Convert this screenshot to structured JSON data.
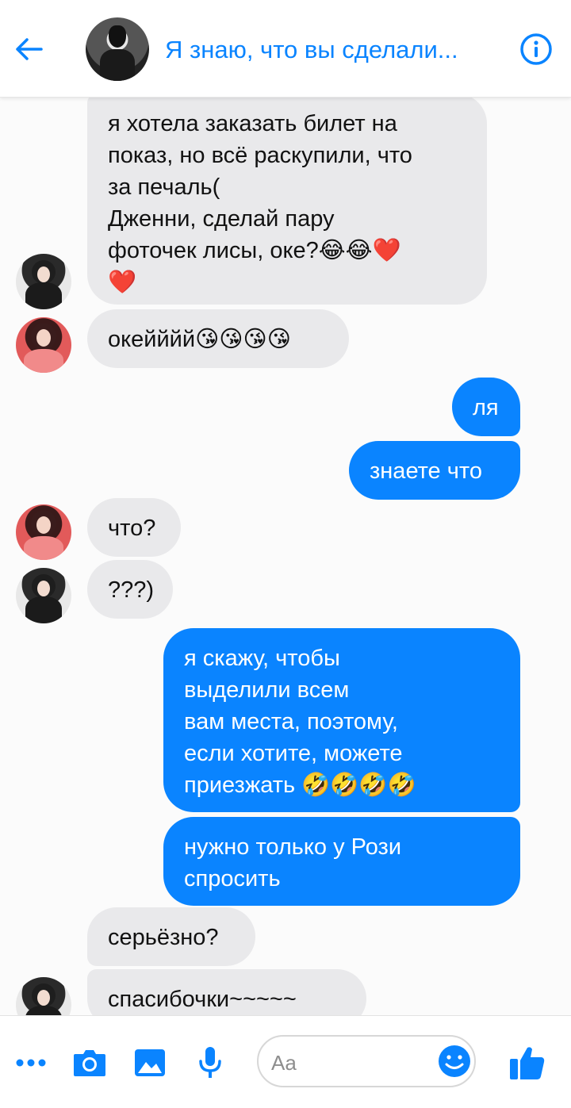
{
  "header": {
    "title": "Я знаю, что вы сделали...",
    "back_icon": "back-arrow-icon",
    "info_icon": "info-icon"
  },
  "colors": {
    "accent": "#0a84ff",
    "incoming_bubble": "#e9e9eb",
    "outgoing_bubble": "#0a84ff"
  },
  "messages": [
    {
      "side": "in",
      "avatar": "dark",
      "text": "я хотела заказать билет на\nпоказ, но всё раскупили, что\nза печаль(\nДженни, сделай пару\nфоточек лисы, оке?😂😂❤️\n❤️"
    },
    {
      "side": "in",
      "avatar": "pink",
      "text": "окейййй😘😘😘😘"
    },
    {
      "side": "out",
      "text": "ля"
    },
    {
      "side": "out",
      "text": "знаете что"
    },
    {
      "side": "in",
      "avatar": "pink",
      "text": "что?"
    },
    {
      "side": "in",
      "avatar": "dark",
      "text": "???)"
    },
    {
      "side": "out",
      "text": "я скажу, чтобы\nвыделили всем\nвам места, поэтому,\nесли хотите, можете\nприезжать 🤣🤣🤣🤣"
    },
    {
      "side": "out",
      "text": "нужно только у Рози\nспросить"
    },
    {
      "side": "in",
      "text": "серьёзно?"
    },
    {
      "side": "in",
      "avatar": "dark",
      "text": "спасибочки~~~~~"
    }
  ],
  "composer": {
    "placeholder": "Aa",
    "icons": [
      "more-icon",
      "camera-icon",
      "image-icon",
      "microphone-icon",
      "emoji-icon",
      "like-icon"
    ]
  }
}
